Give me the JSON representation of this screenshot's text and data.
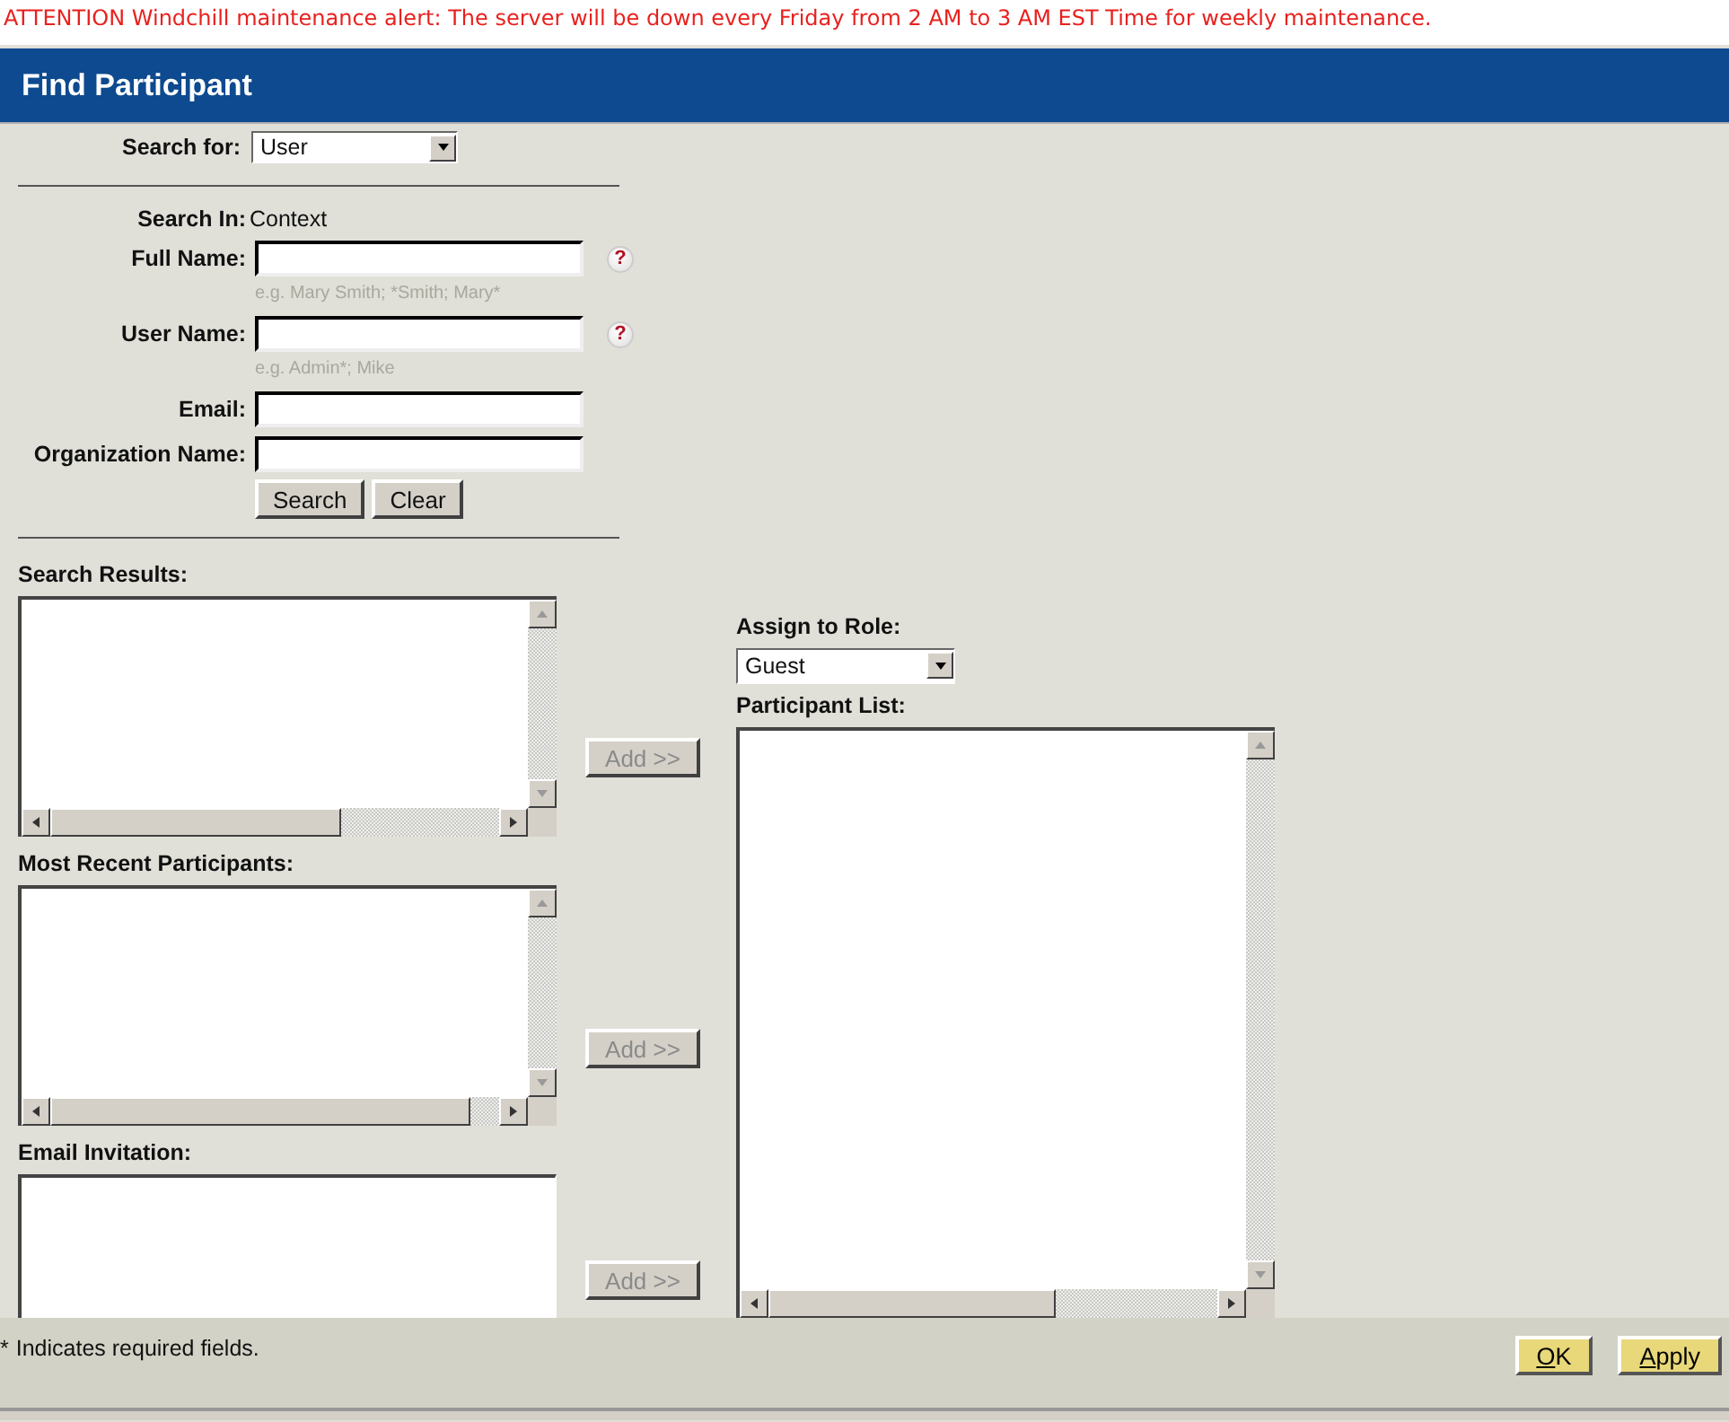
{
  "alert": "ATTENTION Windchill maintenance alert: The server will be down every Friday from 2 AM to 3 AM EST Time for weekly maintenance.",
  "header": {
    "title": "Find Participant"
  },
  "search_for": {
    "label": "Search for:",
    "value": "User"
  },
  "search_in": {
    "label": "Search In:",
    "value": "Context"
  },
  "fields": [
    {
      "label": "Full Name:",
      "help": "?",
      "hint": "e.g. Mary Smith; *Smith; Mary*"
    },
    {
      "label": "User Name:",
      "help": "?",
      "hint": "e.g. Admin*; Mike"
    },
    {
      "label": "Email:"
    },
    {
      "label": "Organization Name:"
    }
  ],
  "search_buttons": [
    "Search",
    "Clear"
  ],
  "lists": [
    {
      "label": "Search Results:",
      "add_button": {
        "label": "Add >>",
        "disabled": true
      }
    },
    {
      "label": "Most Recent Participants:",
      "add_button": {
        "label": "Add >>",
        "disabled": true
      }
    },
    {
      "label": "Email Invitation:",
      "add_button": {
        "label": "Add >>",
        "disabled": true
      }
    }
  ],
  "assign_role": {
    "label": "Assign to Role:",
    "value": "Guest"
  },
  "participant_list": {
    "label": "Participant List:"
  },
  "footer": {
    "note_mark": "*",
    "note": "Indicates required fields.",
    "buttons": [
      "OK",
      "Apply"
    ]
  }
}
